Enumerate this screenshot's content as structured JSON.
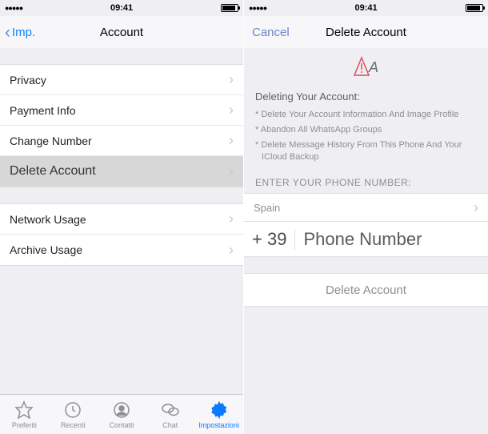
{
  "left": {
    "status": {
      "time": "09:41",
      "signal": "●●●●●"
    },
    "nav": {
      "back": "Imp.",
      "title": "Account"
    },
    "group1": [
      {
        "label": "Privacy"
      },
      {
        "label": "Payment Info"
      },
      {
        "label": "Change Number"
      },
      {
        "label": "Delete Account",
        "selected": true
      }
    ],
    "group2": [
      {
        "label": "Network Usage"
      },
      {
        "label": "Archive Usage"
      }
    ],
    "tabs": [
      {
        "label": "Preferiti"
      },
      {
        "label": "Recenti"
      },
      {
        "label": "Contatti"
      },
      {
        "label": "Chat"
      },
      {
        "label": "Impostazioni",
        "active": true
      }
    ]
  },
  "right": {
    "status": {
      "time": "09:41",
      "signal": "●●●●●"
    },
    "nav": {
      "cancel": "Cancel",
      "title": "Delete Account"
    },
    "warn_glyph": "!A",
    "warn_title": "Deleting Your Account:",
    "bullets": [
      "Delete Your Account Information And Image Profile",
      "Abandon All WhatsApp Groups",
      "Delete Message History From This Phone And Your ICloud Backup"
    ],
    "section_label": "ENTER YOUR PHONE NUMBER:",
    "country": "Spain",
    "cc": "+ 39",
    "phone_placeholder": "Phone Number",
    "delete_button": "Delete Account"
  }
}
